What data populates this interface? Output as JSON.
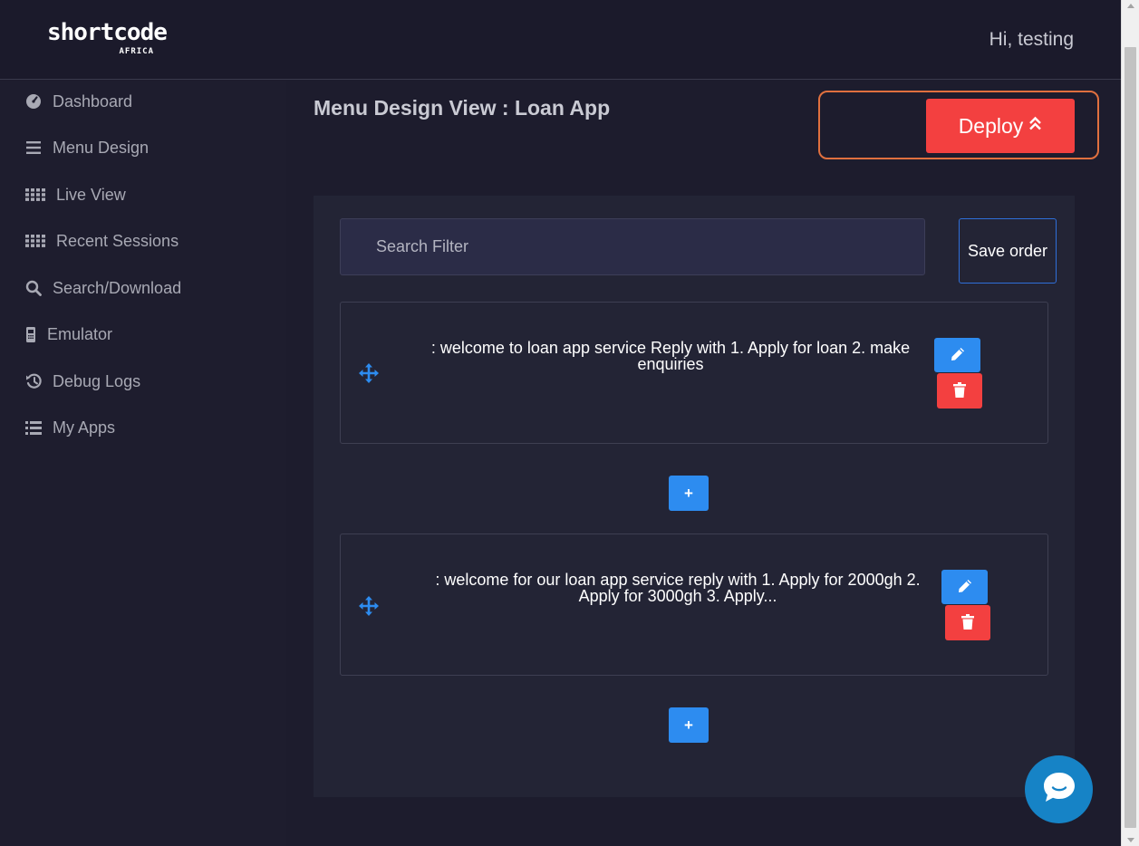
{
  "header": {
    "logo_text": "shortcode",
    "logo_sub": "AFRICA",
    "greeting": "Hi, testing"
  },
  "sidebar": {
    "items": [
      {
        "label": "Dashboard",
        "icon": "dashboard-icon"
      },
      {
        "label": "Menu Design",
        "icon": "bars-icon"
      },
      {
        "label": "Live View",
        "icon": "grid-dots-icon"
      },
      {
        "label": "Recent Sessions",
        "icon": "grid-dots-icon"
      },
      {
        "label": "Search/Download",
        "icon": "search-icon"
      },
      {
        "label": "Emulator",
        "icon": "phone-icon"
      },
      {
        "label": "Debug Logs",
        "icon": "history-icon"
      },
      {
        "label": "My Apps",
        "icon": "list-icon"
      }
    ]
  },
  "main": {
    "title": "Menu Design View : Loan App",
    "deploy_label": "Deploy",
    "search_placeholder": "Search Filter",
    "save_order_label": "Save order",
    "add_label": "+",
    "menu_items": [
      {
        "text": ": welcome to loan app service Reply with 1. Apply for loan 2. make enquiries"
      },
      {
        "text": ": welcome for our loan app service reply with 1. Apply for 2000gh 2. Apply for 3000gh 3. Apply..."
      }
    ]
  },
  "colors": {
    "background": "#1d1c2d",
    "deploy": "#f34040",
    "accent_blue": "#2d8cf0",
    "deploy_outline": "#e0703f",
    "chat": "#1683c6"
  }
}
